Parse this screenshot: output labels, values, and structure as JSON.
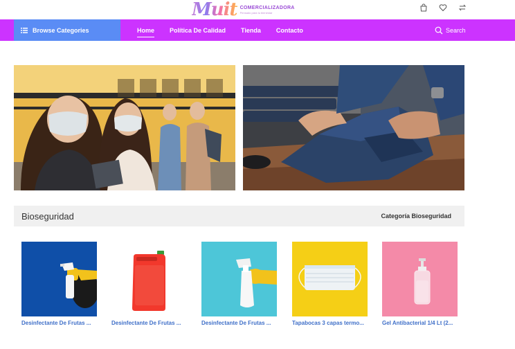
{
  "header": {
    "logo_mark": "Muit",
    "logo_name": "COMERCIALIZADORA",
    "logo_tagline": "Pensado para tu bienestar",
    "icons": [
      "bag-icon",
      "heart-icon",
      "compare-icon"
    ]
  },
  "nav": {
    "browse_label": "Browse Categories",
    "links": [
      "Home",
      "Política De Calidad",
      "Tienda",
      "Contacto"
    ],
    "active": "Home",
    "search_label": "Search"
  },
  "colors": {
    "nav_bg": "#cc33ff",
    "browse_bg": "#5a8cf5",
    "product_link": "#3f6fc8"
  },
  "section": {
    "title": "Bioseguridad",
    "link": "Categoría Bioseguridad"
  },
  "products": [
    {
      "name": "Desinfectante De Frutas ..."
    },
    {
      "name": "Desinfectante De Frutas ..."
    },
    {
      "name": "Desinfectante De Frutas ..."
    },
    {
      "name": "Tapabocas 3 capas termo..."
    },
    {
      "name": "Gel Antibacterial 1/4 Lt (2..."
    }
  ]
}
